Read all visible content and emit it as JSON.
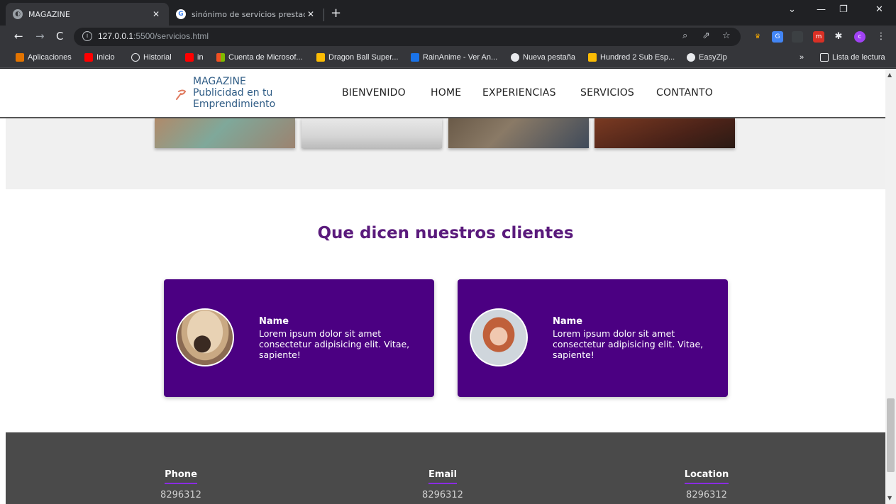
{
  "browser": {
    "tabs": [
      {
        "title": "MAGAZINE",
        "active": true
      },
      {
        "title": "sinónimo de servicios prestados",
        "active": false
      }
    ],
    "url_host": "127.0.0.1",
    "url_rest": ":5500/servicios.html",
    "bookmarks": [
      {
        "label": "Aplicaciones",
        "icon": "apps-icon"
      },
      {
        "label": "Inicio",
        "icon": "youtube-icon"
      },
      {
        "label": "Historial",
        "icon": "history-icon"
      },
      {
        "label": "in",
        "icon": "youtube-icon"
      },
      {
        "label": "Cuenta de Microsof...",
        "icon": "microsoft-icon"
      },
      {
        "label": "Dragon Ball Super...",
        "icon": "bookmark-icon"
      },
      {
        "label": "RainAnime - Ver An...",
        "icon": "ra-icon"
      },
      {
        "label": "Nueva pestaña",
        "icon": "globe-icon"
      },
      {
        "label": "Hundred 2 Sub Esp...",
        "icon": "bookmark-icon"
      },
      {
        "label": "EasyZip",
        "icon": "globe-icon"
      }
    ],
    "reading_list": "Lista de lectura",
    "profile_initial": "c"
  },
  "header": {
    "logo_line1": "MAGAZINE",
    "logo_line2": "Publicidad en tu",
    "logo_line3": "Emprendimiento",
    "nav": [
      "BIENVENIDO",
      "HOME",
      "EXPERIENCIAS",
      "SERVICIOS",
      "CONTANTO"
    ]
  },
  "testimonials": {
    "title": "Que dicen nuestros clientes",
    "cards": [
      {
        "name": "Name",
        "text": "Lorem ipsum dolor sit amet consectetur adipisicing elit. Vitae, sapiente!"
      },
      {
        "name": "Name",
        "text": "Lorem ipsum dolor sit amet consectetur adipisicing elit. Vitae, sapiente!"
      }
    ]
  },
  "footer": {
    "columns": [
      {
        "heading": "Phone",
        "value": "8296312"
      },
      {
        "heading": "Email",
        "value": "8296312"
      },
      {
        "heading": "Location",
        "value": "8296312"
      }
    ]
  },
  "colors": {
    "card_bg": "#4b0082",
    "title": "#5a1a7c",
    "footer_bg": "#4a4a4a",
    "accent_underline": "#8a2be2"
  }
}
